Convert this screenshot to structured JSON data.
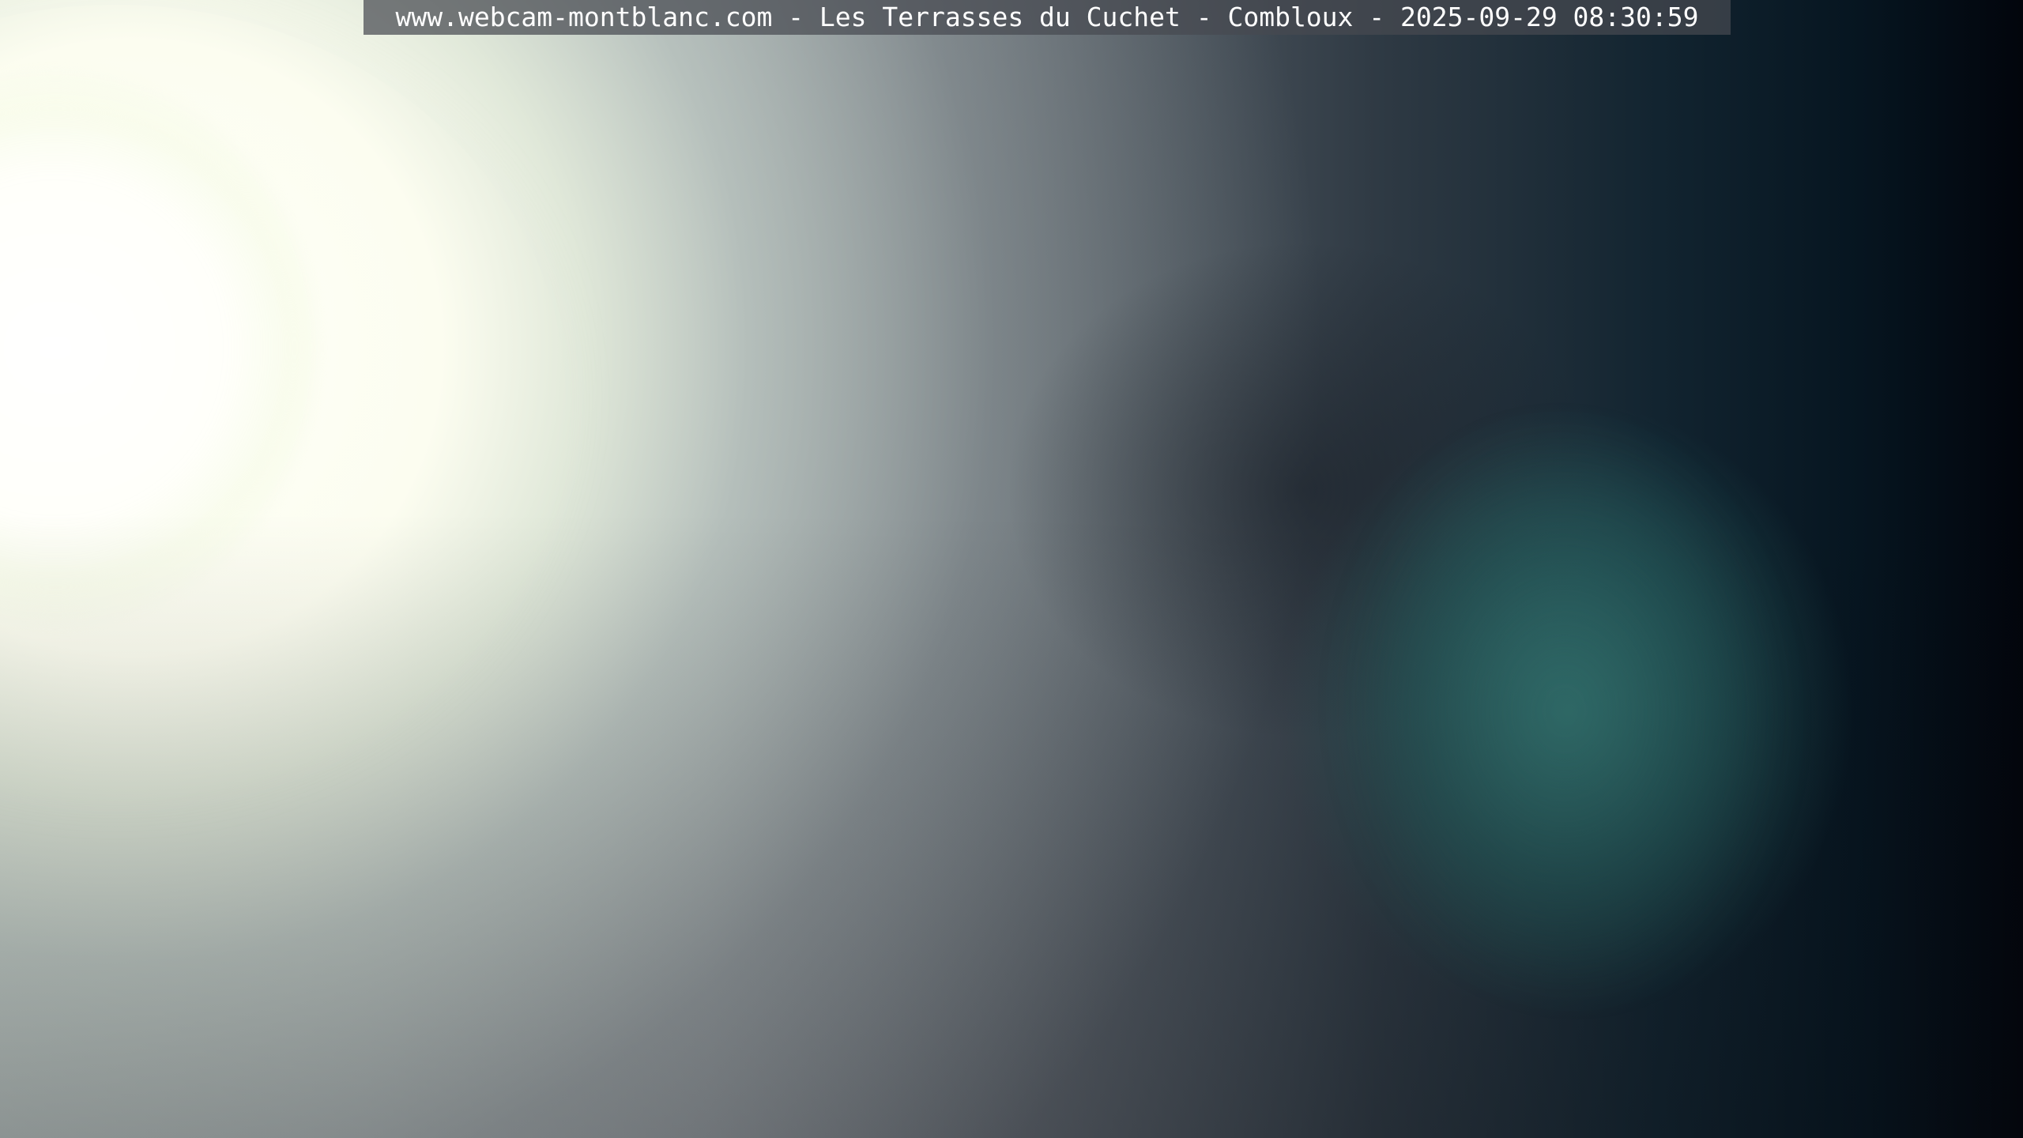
{
  "webcam": {
    "caption": "www.webcam-montblanc.com - Les Terrasses du Cuchet - Combloux - 2025-09-29 08:30:59"
  },
  "colors": {
    "sun": "#ffffff",
    "sky_left": "#b9c1c0",
    "sky_right": "#02050c",
    "teal_flare": "#347672"
  }
}
